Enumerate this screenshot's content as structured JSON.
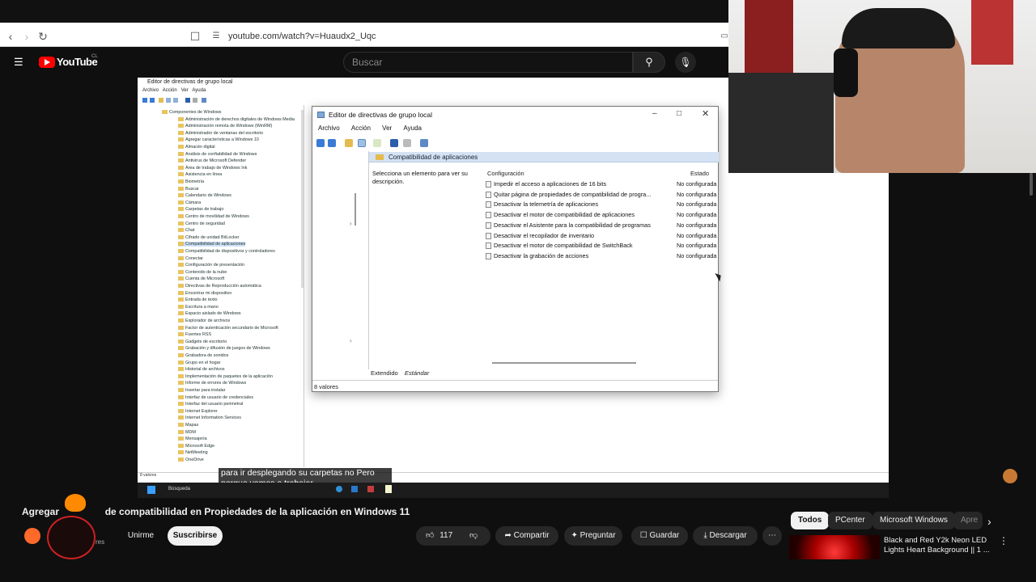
{
  "browser": {
    "url": "youtube.com/watch?v=Huaudx2_Uqc",
    "back_icon": "chevron-left-icon",
    "forward_icon": "chevron-right-icon",
    "reload_icon": "reload-icon"
  },
  "youtube": {
    "logo_text": "YouTube",
    "region_code": "CL",
    "search_placeholder": "Buscar"
  },
  "video": {
    "outer_window": {
      "title": "Editor de directivas de grupo local",
      "menu": [
        "Archivo",
        "Acción",
        "Ver",
        "Ayuda"
      ]
    },
    "tree_items": [
      "Componentes de Windows",
      "Administración de derechos digitales de Windows Media",
      "Administración remota de Windows (WinRM)",
      "Administrador de ventanas del escritorio",
      "Agregar características a Windows 10",
      "Almacén digital",
      "Análisis de confiabilidad de Windows",
      "Antivirus de Microsoft Defender",
      "Área de trabajo de Windows Ink",
      "Asistencia en línea",
      "Biometría",
      "Buscar",
      "Calendario de Windows",
      "Cámara",
      "Carpetas de trabajo",
      "Centro de movilidad de Windows",
      "Centro de seguridad",
      "Chat",
      "Cifrado de unidad BitLocker",
      "Compatibilidad de aplicaciones",
      "Compatibilidad de dispositivos y controladores",
      "Conectar",
      "Configuración de presentación",
      "Contenido de la nube",
      "Cuenta de Microsoft",
      "Directivas de Reproducción automática",
      "Encontrar mi dispositivo",
      "Entrada de texto",
      "Escritura a mano",
      "Espacio aislado de Windows",
      "Explorador de archivos",
      "Factor de autenticación secundario de Microsoft",
      "Fuentes RSS",
      "Gadgets de escritorio",
      "Grabación y difusión de juegos de Windows",
      "Grabadora de sonidos",
      "Grupo en el hogar",
      "Historial de archivos",
      "Implementación de paquetes de la aplicación",
      "Informe de errores de Windows",
      "Insertar para instalar",
      "Interfaz de usuario de credenciales",
      "Interfaz del usuario perimetral",
      "Internet Explorer",
      "Internet Information Services",
      "Mapas",
      "MDM",
      "Mensajería",
      "Microsoft Edge",
      "NetMeeting",
      "OneDrive"
    ],
    "outer_status": "8 valores",
    "dialog": {
      "title": "Editor de directivas de grupo local",
      "menu": [
        "Archivo",
        "Acción",
        "Ver",
        "Ayuda"
      ],
      "section_title": "Compatibilidad de aplicaciones",
      "description": "Selecciona un elemento para ver su descripción.",
      "col_config": "Configuración",
      "col_state": "Estado",
      "rows": [
        {
          "name": "Impedir el acceso a aplicaciones de 16 bits",
          "state": "No configurada"
        },
        {
          "name": "Quitar página de propiedades de compatibilidad de progra...",
          "state": "No configurada"
        },
        {
          "name": "Desactivar la telemetría de aplicaciones",
          "state": "No configurada"
        },
        {
          "name": "Desactivar el motor de compatibilidad de aplicaciones",
          "state": "No configurada"
        },
        {
          "name": "Desactivar el Asistente para la compatibilidad de programas",
          "state": "No configurada"
        },
        {
          "name": "Desactivar el recopilador de inventario",
          "state": "No configurada"
        },
        {
          "name": "Desactivar el motor de compatibilidad de SwitchBack",
          "state": "No configurada"
        },
        {
          "name": "Desactivar la grabación de acciones",
          "state": "No configurada"
        }
      ],
      "tab_extended": "Extendido",
      "tab_standard": "Estándar",
      "status": "8 valores"
    },
    "caption_line1": "para ir desplegando su carpetas no Pero",
    "caption_line2": "porque vamos a trabajar",
    "taskbar_search": "Búsqueda"
  },
  "info": {
    "title": "Agregar pestaña de compatibilidad en Propiedades de la aplicación en Windows 11",
    "title_visible_start": "Agregar",
    "title_visible_rest": "de compatibilidad en Propiedades de la aplicación en Windows 11",
    "channel_suffix": "res",
    "join": "Unirme",
    "subscribe": "Suscribirse",
    "likes": "117",
    "share": "Compartir",
    "ask": "Preguntar",
    "save": "Guardar",
    "download": "Descargar"
  },
  "chips": [
    "Todos",
    "PCenter",
    "Microsoft Windows",
    "Apre"
  ],
  "recommended": {
    "title_line1": "Black and Red Y2k Neon LED",
    "title_line2": "Lights Heart Background || 1 ..."
  }
}
